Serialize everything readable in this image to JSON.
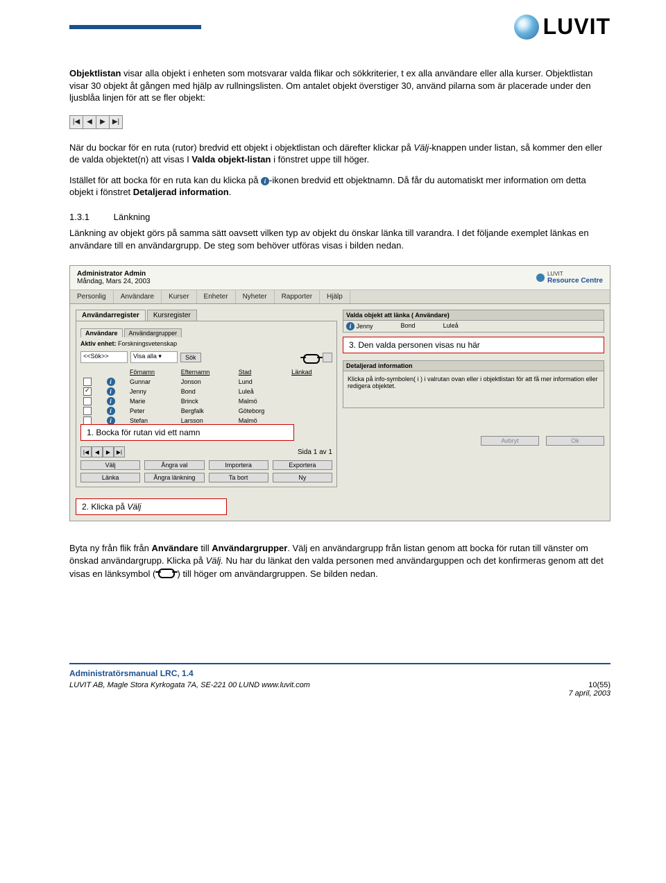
{
  "header": {
    "logo_text": "LUVIT"
  },
  "para1_a": "Objektlistan",
  "para1_b": " visar alla objekt i enheten som motsvarar valda flikar och sökkriterier, t ex alla användare eller alla kurser. Objektlistan visar 30 objekt åt gången med hjälp av rullningslisten. Om antalet objekt överstiger 30, använd pilarna som är placerade under den ljusblåa linjen för att se fler objekt:",
  "para2_a": "När du bockar för en ruta (rutor) bredvid ett objekt i objektlistan och därefter klickar på ",
  "para2_b": "Välj-",
  "para2_c": "knappen under listan, så kommer den eller de valda objektet(n) att visas I ",
  "para2_d": "Valda objekt-listan",
  "para2_e": " i fönstret uppe till höger.",
  "para3_a": "Istället för att bocka för en ruta kan du klicka på ",
  "para3_b": "-ikonen bredvid ett objektnamn. Då får du automatiskt mer information om detta objekt i fönstret ",
  "para3_c": "Detaljerad information",
  "para3_d": ".",
  "section_num": "1.3.1",
  "section_title": "Länkning",
  "para4": "Länkning av objekt görs på samma sätt oavsett vilken typ av objekt du önskar länka till varandra. I det följande exemplet länkas en användare till en användargrupp. De steg som behöver utföras visas i bilden nedan.",
  "app": {
    "admin_title": "Administrator Admin",
    "admin_date": "Måndag, Mars 24, 2003",
    "rc_small": "LUVIT",
    "rc_big": "Resource Centre",
    "menu": [
      "Personlig",
      "Användare",
      "Kurser",
      "Enheter",
      "Nyheter",
      "Rapporter",
      "Hjälp"
    ],
    "tab1": "Användarregister",
    "tab2": "Kursregister",
    "subtab1": "Användare",
    "subtab2": "Användargrupper",
    "aktiv_label": "Aktiv enhet:",
    "aktiv_value": "Forskningsvetenskap",
    "search_ph": "<<Sök>>",
    "visa_label": "Visa alla",
    "sok_btn": "Sök",
    "cols": {
      "c1": "Förnamn",
      "c2": "Efternamn",
      "c3": "Stad",
      "c4": "Länkad"
    },
    "rows": [
      {
        "checked": false,
        "fn": "Gunnar",
        "en": "Jonson",
        "stad": "Lund"
      },
      {
        "checked": true,
        "fn": "Jenny",
        "en": "Bond",
        "stad": "Luleå"
      },
      {
        "checked": false,
        "fn": "Marie",
        "en": "Brinck",
        "stad": "Malmö"
      },
      {
        "checked": false,
        "fn": "Peter",
        "en": "Bergfalk",
        "stad": "Göteborg"
      },
      {
        "checked": false,
        "fn": "Stefan",
        "en": "Larsson",
        "stad": "Malmö"
      }
    ],
    "callout1": "1. Bocka för rutan vid ett namn",
    "pager_text": "Sida 1 av 1",
    "btns1": [
      "Välj",
      "Ångra val",
      "Importera",
      "Exportera"
    ],
    "btns2": [
      "Länka",
      "Ångra länkning",
      "Ta bort",
      "Ny"
    ],
    "callout2": "2. Klicka på Välj",
    "sel_header": "Valda objekt att länka ( Användare)",
    "sel_fn": "Jenny",
    "sel_en": "Bond",
    "sel_stad": "Luleå",
    "callout3": "3. Den valda personen visas nu här",
    "det_header": "Detaljerad information",
    "det_body": "Klicka på info-symbolen( i ) i valrutan ovan eller i objektlistan för att få mer information eller redigera objektet.",
    "avbryt": "Avbryt",
    "ok": "Ok"
  },
  "para5_a": "Byta ny från flik från ",
  "para5_b": "Användare",
  "para5_c": " till ",
  "para5_d": "Användargrupper",
  "para5_e": ". Välj en användargrupp från listan genom att bocka för rutan till vänster om önskad användargrupp. Klicka på ",
  "para5_f": "Välj.",
  "para5_g": " Nu har du länkat den valda personen med användarguppen och det konfirmeras genom att det visas en länksymbol ( ",
  "para5_h": " ) till höger om användargruppen. Se bilden nedan.",
  "footer": {
    "title": "Administratörsmanual LRC, 1.4",
    "page": "10(55)",
    "addr": "LUVIT AB, Magle Stora Kyrkogata 7A, SE-221 00  LUND www.luvit.com",
    "date": "7 april, 2003"
  }
}
